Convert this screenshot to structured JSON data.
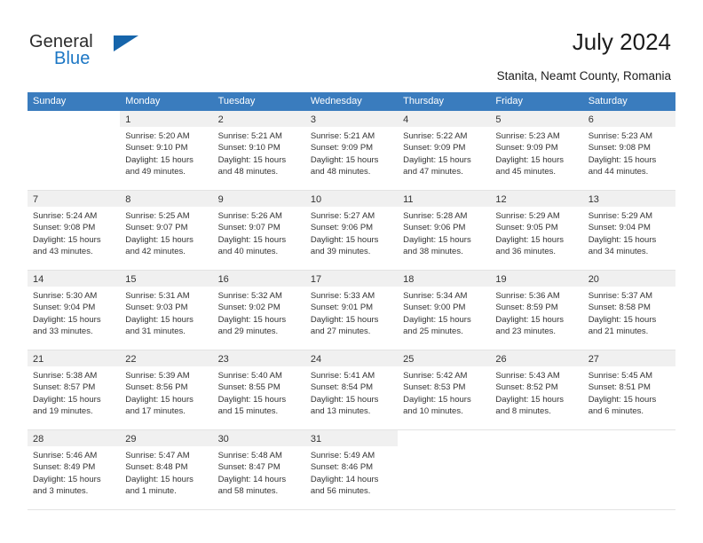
{
  "logo": {
    "word1": "General",
    "word2": "Blue",
    "triangle_color": "#1665ab",
    "blue_color": "#1b76c4"
  },
  "header": {
    "title": "July 2024",
    "location": "Stanita, Neamt County, Romania"
  },
  "calendar": {
    "header_bg": "#3a7cbe",
    "daynum_bg": "#f0f0f0",
    "weekdays": [
      "Sunday",
      "Monday",
      "Tuesday",
      "Wednesday",
      "Thursday",
      "Friday",
      "Saturday"
    ],
    "weeks": [
      [
        {
          "day": "",
          "lines": []
        },
        {
          "day": "1",
          "lines": [
            "Sunrise: 5:20 AM",
            "Sunset: 9:10 PM",
            "Daylight: 15 hours",
            "and 49 minutes."
          ]
        },
        {
          "day": "2",
          "lines": [
            "Sunrise: 5:21 AM",
            "Sunset: 9:10 PM",
            "Daylight: 15 hours",
            "and 48 minutes."
          ]
        },
        {
          "day": "3",
          "lines": [
            "Sunrise: 5:21 AM",
            "Sunset: 9:09 PM",
            "Daylight: 15 hours",
            "and 48 minutes."
          ]
        },
        {
          "day": "4",
          "lines": [
            "Sunrise: 5:22 AM",
            "Sunset: 9:09 PM",
            "Daylight: 15 hours",
            "and 47 minutes."
          ]
        },
        {
          "day": "5",
          "lines": [
            "Sunrise: 5:23 AM",
            "Sunset: 9:09 PM",
            "Daylight: 15 hours",
            "and 45 minutes."
          ]
        },
        {
          "day": "6",
          "lines": [
            "Sunrise: 5:23 AM",
            "Sunset: 9:08 PM",
            "Daylight: 15 hours",
            "and 44 minutes."
          ]
        }
      ],
      [
        {
          "day": "7",
          "lines": [
            "Sunrise: 5:24 AM",
            "Sunset: 9:08 PM",
            "Daylight: 15 hours",
            "and 43 minutes."
          ]
        },
        {
          "day": "8",
          "lines": [
            "Sunrise: 5:25 AM",
            "Sunset: 9:07 PM",
            "Daylight: 15 hours",
            "and 42 minutes."
          ]
        },
        {
          "day": "9",
          "lines": [
            "Sunrise: 5:26 AM",
            "Sunset: 9:07 PM",
            "Daylight: 15 hours",
            "and 40 minutes."
          ]
        },
        {
          "day": "10",
          "lines": [
            "Sunrise: 5:27 AM",
            "Sunset: 9:06 PM",
            "Daylight: 15 hours",
            "and 39 minutes."
          ]
        },
        {
          "day": "11",
          "lines": [
            "Sunrise: 5:28 AM",
            "Sunset: 9:06 PM",
            "Daylight: 15 hours",
            "and 38 minutes."
          ]
        },
        {
          "day": "12",
          "lines": [
            "Sunrise: 5:29 AM",
            "Sunset: 9:05 PM",
            "Daylight: 15 hours",
            "and 36 minutes."
          ]
        },
        {
          "day": "13",
          "lines": [
            "Sunrise: 5:29 AM",
            "Sunset: 9:04 PM",
            "Daylight: 15 hours",
            "and 34 minutes."
          ]
        }
      ],
      [
        {
          "day": "14",
          "lines": [
            "Sunrise: 5:30 AM",
            "Sunset: 9:04 PM",
            "Daylight: 15 hours",
            "and 33 minutes."
          ]
        },
        {
          "day": "15",
          "lines": [
            "Sunrise: 5:31 AM",
            "Sunset: 9:03 PM",
            "Daylight: 15 hours",
            "and 31 minutes."
          ]
        },
        {
          "day": "16",
          "lines": [
            "Sunrise: 5:32 AM",
            "Sunset: 9:02 PM",
            "Daylight: 15 hours",
            "and 29 minutes."
          ]
        },
        {
          "day": "17",
          "lines": [
            "Sunrise: 5:33 AM",
            "Sunset: 9:01 PM",
            "Daylight: 15 hours",
            "and 27 minutes."
          ]
        },
        {
          "day": "18",
          "lines": [
            "Sunrise: 5:34 AM",
            "Sunset: 9:00 PM",
            "Daylight: 15 hours",
            "and 25 minutes."
          ]
        },
        {
          "day": "19",
          "lines": [
            "Sunrise: 5:36 AM",
            "Sunset: 8:59 PM",
            "Daylight: 15 hours",
            "and 23 minutes."
          ]
        },
        {
          "day": "20",
          "lines": [
            "Sunrise: 5:37 AM",
            "Sunset: 8:58 PM",
            "Daylight: 15 hours",
            "and 21 minutes."
          ]
        }
      ],
      [
        {
          "day": "21",
          "lines": [
            "Sunrise: 5:38 AM",
            "Sunset: 8:57 PM",
            "Daylight: 15 hours",
            "and 19 minutes."
          ]
        },
        {
          "day": "22",
          "lines": [
            "Sunrise: 5:39 AM",
            "Sunset: 8:56 PM",
            "Daylight: 15 hours",
            "and 17 minutes."
          ]
        },
        {
          "day": "23",
          "lines": [
            "Sunrise: 5:40 AM",
            "Sunset: 8:55 PM",
            "Daylight: 15 hours",
            "and 15 minutes."
          ]
        },
        {
          "day": "24",
          "lines": [
            "Sunrise: 5:41 AM",
            "Sunset: 8:54 PM",
            "Daylight: 15 hours",
            "and 13 minutes."
          ]
        },
        {
          "day": "25",
          "lines": [
            "Sunrise: 5:42 AM",
            "Sunset: 8:53 PM",
            "Daylight: 15 hours",
            "and 10 minutes."
          ]
        },
        {
          "day": "26",
          "lines": [
            "Sunrise: 5:43 AM",
            "Sunset: 8:52 PM",
            "Daylight: 15 hours",
            "and 8 minutes."
          ]
        },
        {
          "day": "27",
          "lines": [
            "Sunrise: 5:45 AM",
            "Sunset: 8:51 PM",
            "Daylight: 15 hours",
            "and 6 minutes."
          ]
        }
      ],
      [
        {
          "day": "28",
          "lines": [
            "Sunrise: 5:46 AM",
            "Sunset: 8:49 PM",
            "Daylight: 15 hours",
            "and 3 minutes."
          ]
        },
        {
          "day": "29",
          "lines": [
            "Sunrise: 5:47 AM",
            "Sunset: 8:48 PM",
            "Daylight: 15 hours",
            "and 1 minute."
          ]
        },
        {
          "day": "30",
          "lines": [
            "Sunrise: 5:48 AM",
            "Sunset: 8:47 PM",
            "Daylight: 14 hours",
            "and 58 minutes."
          ]
        },
        {
          "day": "31",
          "lines": [
            "Sunrise: 5:49 AM",
            "Sunset: 8:46 PM",
            "Daylight: 14 hours",
            "and 56 minutes."
          ]
        },
        {
          "day": "",
          "lines": []
        },
        {
          "day": "",
          "lines": []
        },
        {
          "day": "",
          "lines": []
        }
      ]
    ]
  }
}
